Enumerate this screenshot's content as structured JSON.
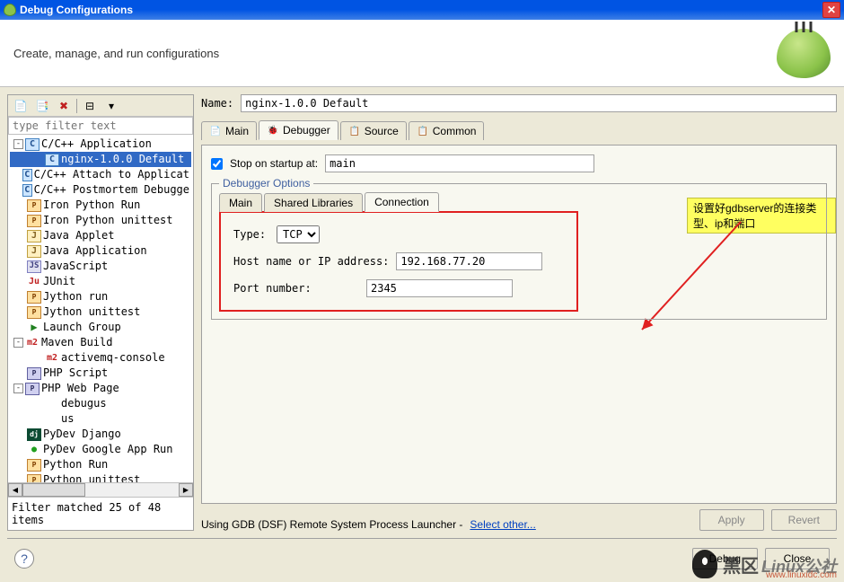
{
  "window": {
    "title": "Debug Configurations"
  },
  "header": {
    "text": "Create, manage, and run configurations"
  },
  "filter": {
    "placeholder": "type filter text",
    "status": "Filter matched 25 of 48 items"
  },
  "tree": [
    {
      "label": "C/C++ Application",
      "indent": 0,
      "icon": "c",
      "expander": "-"
    },
    {
      "label": "nginx-1.0.0 Default",
      "indent": 1,
      "icon": "c",
      "selected": true
    },
    {
      "label": "C/C++ Attach to Applicat",
      "indent": 0,
      "icon": "c"
    },
    {
      "label": "C/C++ Postmortem Debugge",
      "indent": 0,
      "icon": "c"
    },
    {
      "label": "Iron Python Run",
      "indent": 0,
      "icon": "py"
    },
    {
      "label": "Iron Python unittest",
      "indent": 0,
      "icon": "py"
    },
    {
      "label": "Java Applet",
      "indent": 0,
      "icon": "java"
    },
    {
      "label": "Java Application",
      "indent": 0,
      "icon": "java"
    },
    {
      "label": "JavaScript",
      "indent": 0,
      "icon": "js"
    },
    {
      "label": "JUnit",
      "indent": 0,
      "icon": "ju"
    },
    {
      "label": "Jython run",
      "indent": 0,
      "icon": "py"
    },
    {
      "label": "Jython unittest",
      "indent": 0,
      "icon": "py"
    },
    {
      "label": "Launch Group",
      "indent": 0,
      "icon": "run"
    },
    {
      "label": "Maven Build",
      "indent": 0,
      "icon": "m2",
      "expander": "-"
    },
    {
      "label": "activemq-console",
      "indent": 1,
      "icon": "m2"
    },
    {
      "label": "PHP Script",
      "indent": 0,
      "icon": "php"
    },
    {
      "label": "PHP Web Page",
      "indent": 0,
      "icon": "php",
      "expander": "-"
    },
    {
      "label": "debugus",
      "indent": 1,
      "icon": ""
    },
    {
      "label": "us",
      "indent": 1,
      "icon": ""
    },
    {
      "label": "PyDev Django",
      "indent": 0,
      "icon": "dj"
    },
    {
      "label": "PyDev Google App Run",
      "indent": 0,
      "icon": "gr"
    },
    {
      "label": "Python Run",
      "indent": 0,
      "icon": "py"
    },
    {
      "label": "Python unittest",
      "indent": 0,
      "icon": "py"
    }
  ],
  "name": {
    "label": "Name:",
    "value": "nginx-1.0.0 Default"
  },
  "tabs": {
    "main": "Main",
    "debugger": "Debugger",
    "source": "Source",
    "common": "Common"
  },
  "stopOnStartup": {
    "checked": true,
    "label": "Stop on startup at:",
    "value": "main"
  },
  "debuggerOptions": {
    "legend": "Debugger Options",
    "tabs": {
      "main": "Main",
      "shared": "Shared Libraries",
      "connection": "Connection"
    },
    "type": {
      "label": "Type:",
      "value": "TCP"
    },
    "host": {
      "label": "Host name or IP address:",
      "value": "192.168.77.20"
    },
    "port": {
      "label": "Port number:",
      "value": "2345"
    }
  },
  "annotation": "设置好gdbserver的连接类型、ip和端口",
  "launcher": {
    "prefix": "Using GDB (DSF) Remote System Process Launcher - ",
    "link": "Select other..."
  },
  "buttons": {
    "apply": "Apply",
    "revert": "Revert",
    "debug": "Debug",
    "close": "Close"
  },
  "watermark": {
    "txt1": "黑区",
    "txt2": "Linux公社",
    "url": "www.linuxidc.com"
  }
}
